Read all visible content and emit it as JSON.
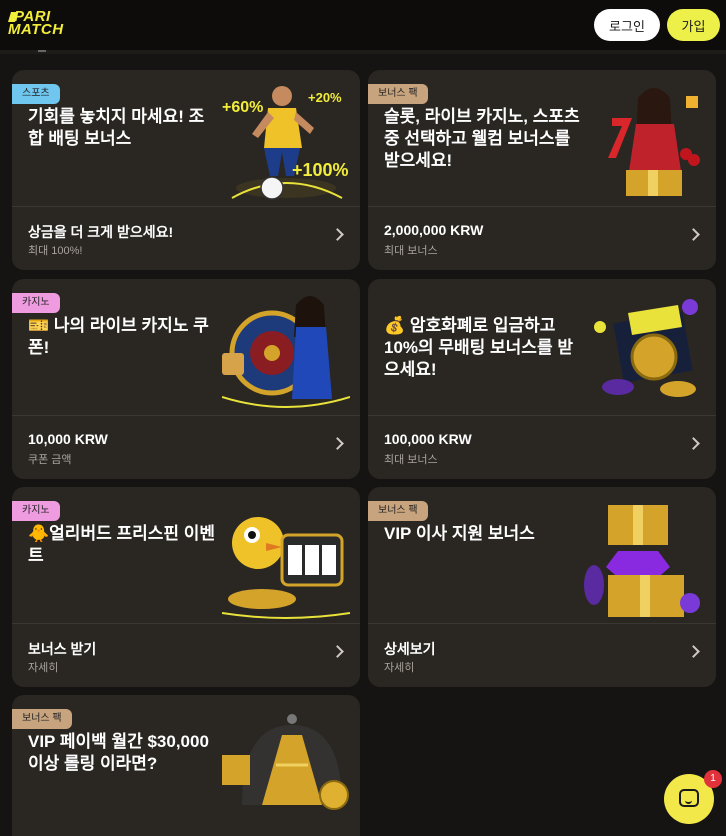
{
  "header": {
    "logo_line1": "PARI",
    "logo_line2": "MATCH",
    "login_label": "로그인",
    "join_label": "가입"
  },
  "colors": {
    "accent": "#eef04a",
    "card_bg": "#2a2723",
    "badge_sports": "#6fc6ef",
    "badge_bonus": "#c8a47e",
    "badge_casino": "#ee9be0"
  },
  "cards": [
    {
      "badge": "스포츠",
      "title": "기회를 놓치지 마세요! 조합 배팅 보너스",
      "main": "상금을 더 크게 받으세요!",
      "sub": "최대 100%!",
      "art": [
        "+60%",
        "+20%",
        "+100%"
      ]
    },
    {
      "badge": "보너스 팩",
      "title": "슬롯, 라이브 카지노, 스포츠 중 선택하고 웰컴 보너스를 받으세요!",
      "main": "2,000,000 KRW",
      "sub": "최대 보너스"
    },
    {
      "badge": "카지노",
      "title": "🎫 나의 라이브 카지노 쿠폰!",
      "main": "10,000 KRW",
      "sub": "쿠폰 금액"
    },
    {
      "badge": "",
      "title": "💰 암호화폐로 입금하고 10%의 무배팅 보너스를 받으세요!",
      "main": "100,000 KRW",
      "sub": "최대 보너스"
    },
    {
      "badge": "카지노",
      "title": "🐥얼리버드 프리스핀 이벤트",
      "main": "보너스 받기",
      "sub": "자세히"
    },
    {
      "badge": "보너스 팩",
      "title": "VIP 이사 지원 보너스",
      "main": "상세보기",
      "sub": "자세히"
    },
    {
      "badge": "보너스 팩",
      "title": "VIP 페이백 월간 $30,000 이상 롤링 이라면?",
      "main": "",
      "sub": ""
    }
  ],
  "chat": {
    "icon": "chat-icon",
    "count": "1"
  }
}
